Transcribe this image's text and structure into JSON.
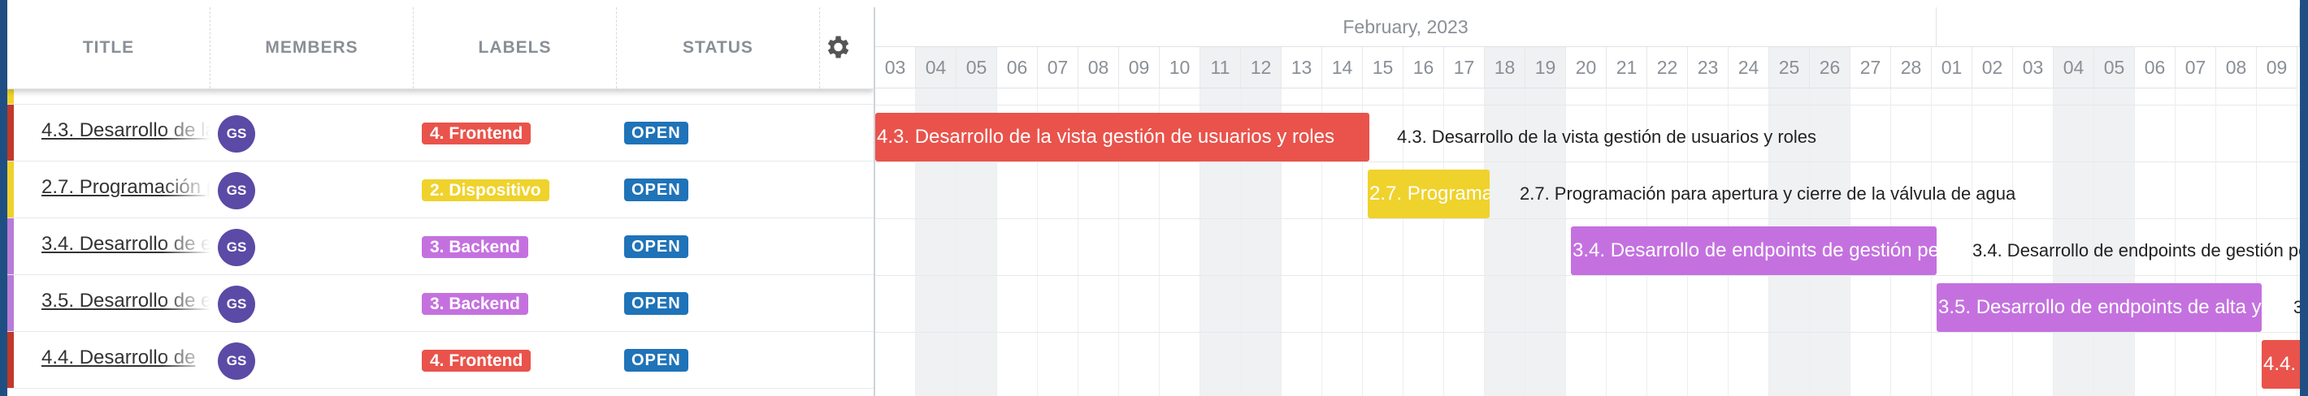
{
  "columns": {
    "title": "TITLE",
    "members": "MEMBERS",
    "labels": "LABELS",
    "status": "STATUS"
  },
  "icons": {
    "settings": "gear-icon"
  },
  "colors": {
    "frontend": "#e9534b",
    "dispositivo": "#efd22c",
    "backend": "#c471df",
    "status": "#1f73b8",
    "avatar": "#5b4aa6"
  },
  "rows": [
    {
      "title": "4.3. Desarrollo de la vista gestión de usuarios y roles",
      "member": "GS",
      "label": "4. Frontend",
      "status": "OPEN"
    },
    {
      "title": "2.7. Programación para apertura y cierre de la válvula de agua",
      "member": "GS",
      "label": "2. Dispositivo",
      "status": "OPEN"
    },
    {
      "title": "3.4. Desarrollo de endpoints de gestión pe",
      "member": "GS",
      "label": "3. Backend",
      "status": "OPEN"
    },
    {
      "title": "3.5. Desarrollo de endpoints de alta y",
      "member": "GS",
      "label": "3. Backend",
      "status": "OPEN"
    },
    {
      "title": "4.4. Desarrollo de",
      "member": "GS",
      "label": "4. Frontend",
      "status": "OPEN"
    }
  ],
  "gantt": {
    "month": "February, 2023",
    "days": [
      "03",
      "04",
      "05",
      "06",
      "07",
      "08",
      "09",
      "10",
      "11",
      "12",
      "13",
      "14",
      "15",
      "16",
      "17",
      "18",
      "19",
      "20",
      "21",
      "22",
      "23",
      "24",
      "25",
      "26",
      "27",
      "28",
      "01",
      "02",
      "03",
      "04",
      "05",
      "06",
      "07",
      "08",
      "09"
    ],
    "weekend_days": [
      "04",
      "05",
      "11",
      "12",
      "18",
      "19",
      "25",
      "26"
    ],
    "bars": [
      {
        "text": "4.3. Desarrollo de la vista gestión de usuarios y roles",
        "external": "4.3. Desarrollo de la vista gestión de usuarios y roles"
      },
      {
        "text": "2.7. Programa",
        "external": "2.7. Programación para apertura y cierre de la válvula de agua"
      },
      {
        "text": "3.4. Desarrollo de endpoints de gestión pe",
        "external": "3.4. Desarrollo de endpoints de gestión pe"
      },
      {
        "text": "3.5. Desarrollo de endpoints de alta y",
        "external": "3"
      },
      {
        "text": "4.4. D",
        "external": ""
      }
    ]
  }
}
